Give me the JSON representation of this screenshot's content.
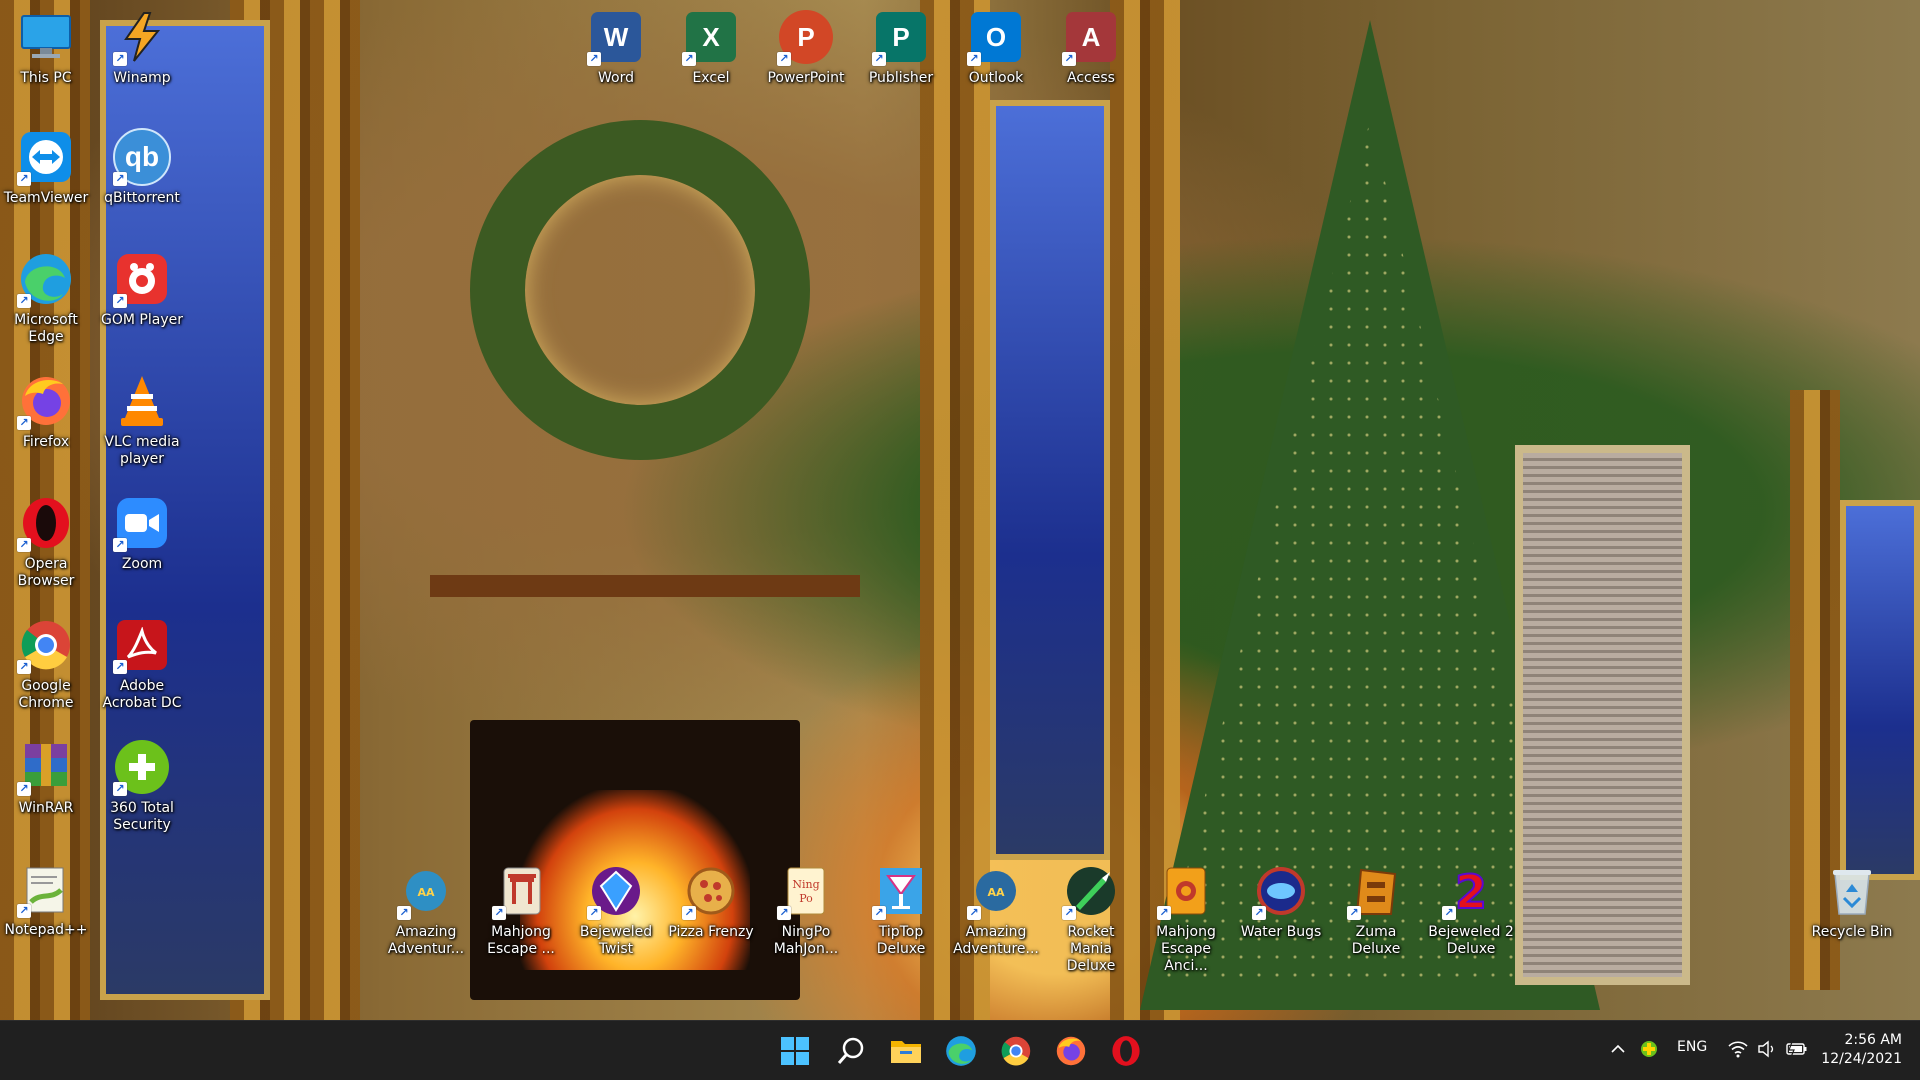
{
  "desktop": {
    "icons_left": [
      {
        "label": "This PC",
        "icon": "monitor-icon"
      },
      {
        "label": "Winamp",
        "icon": "winamp-icon"
      },
      {
        "label": "TeamViewer",
        "icon": "teamviewer-icon"
      },
      {
        "label": "qBittorrent",
        "icon": "qbittorrent-icon"
      },
      {
        "label": "Microsoft Edge",
        "icon": "edge-icon"
      },
      {
        "label": "GOM Player",
        "icon": "gom-player-icon"
      },
      {
        "label": "Firefox",
        "icon": "firefox-icon"
      },
      {
        "label": "VLC media player",
        "icon": "vlc-icon"
      },
      {
        "label": "Opera Browser",
        "icon": "opera-icon"
      },
      {
        "label": "Zoom",
        "icon": "zoom-icon"
      },
      {
        "label": "Google Chrome",
        "icon": "chrome-icon"
      },
      {
        "label": "Adobe Acrobat DC",
        "icon": "acrobat-icon"
      },
      {
        "label": "WinRAR",
        "icon": "winrar-icon"
      },
      {
        "label": "360 Total Security",
        "icon": "360-security-icon"
      },
      {
        "label": "Notepad++",
        "icon": "notepadpp-icon"
      }
    ],
    "icons_top": [
      {
        "label": "Word",
        "letter": "W",
        "color": "#2b579a"
      },
      {
        "label": "Excel",
        "letter": "X",
        "color": "#217346"
      },
      {
        "label": "PowerPoint",
        "letter": "P",
        "color": "#d24726"
      },
      {
        "label": "Publisher",
        "letter": "P",
        "color": "#077568"
      },
      {
        "label": "Outlook",
        "letter": "O",
        "color": "#0078d4"
      },
      {
        "label": "Access",
        "letter": "A",
        "color": "#a4373a"
      }
    ],
    "icons_bottom": [
      {
        "label": "Amazing Adventur...",
        "icon": "amazing-adventures-icon"
      },
      {
        "label": "Mahjong Escape ...",
        "icon": "mahjong-escape-icon"
      },
      {
        "label": "Bejeweled Twist",
        "icon": "bejeweled-twist-icon"
      },
      {
        "label": "Pizza Frenzy",
        "icon": "pizza-frenzy-icon"
      },
      {
        "label": "NingPo MahJon...",
        "icon": "ningpo-mahjong-icon"
      },
      {
        "label": "TipTop Deluxe",
        "icon": "tiptop-deluxe-icon"
      },
      {
        "label": "Amazing Adventure...",
        "icon": "amazing-adventures-2-icon"
      },
      {
        "label": "Rocket Mania Deluxe",
        "icon": "rocket-mania-icon"
      },
      {
        "label": "Mahjong Escape Anci...",
        "icon": "mahjong-escape-ancient-icon"
      },
      {
        "label": "Water Bugs",
        "icon": "water-bugs-icon"
      },
      {
        "label": "Zuma Deluxe",
        "icon": "zuma-deluxe-icon"
      },
      {
        "label": "Bejeweled 2 Deluxe",
        "icon": "bejeweled-2-icon"
      }
    ],
    "recycle_bin": {
      "label": "Recycle Bin"
    }
  },
  "taskbar": {
    "apps": [
      "start-icon",
      "search-icon",
      "file-explorer-icon",
      "edge-icon",
      "chrome-icon",
      "firefox-icon",
      "opera-icon"
    ],
    "tray": {
      "language": "ENG",
      "time": "2:56 AM",
      "date": "12/24/2021"
    }
  },
  "colors": {
    "taskbar_bg": "#202020",
    "label_text": "#ffffff"
  }
}
